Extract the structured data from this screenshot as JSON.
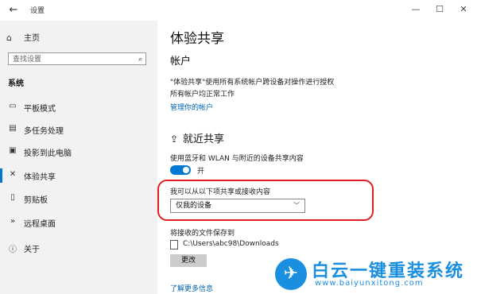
{
  "window": {
    "title": "设置",
    "controls": {
      "minimize": "—",
      "maximize": "☐",
      "close": "✕"
    },
    "back_glyph": "←"
  },
  "sidebar": {
    "home": {
      "label": "主页",
      "icon": "home-icon"
    },
    "search": {
      "placeholder": "查找设置",
      "icon": "search-icon"
    },
    "section_label": "系统",
    "items": [
      {
        "label": "平板模式",
        "icon": "tablet-icon"
      },
      {
        "label": "多任务处理",
        "icon": "multitask-icon"
      },
      {
        "label": "投影到此电脑",
        "icon": "project-icon"
      },
      {
        "label": "体验共享",
        "icon": "share-icon",
        "active": true
      },
      {
        "label": "剪贴板",
        "icon": "clipboard-icon"
      },
      {
        "label": "远程桌面",
        "icon": "remote-icon"
      },
      {
        "label": "关于",
        "icon": "info-icon"
      }
    ]
  },
  "main": {
    "page_title": "体验共享",
    "account": {
      "heading": "帐户",
      "line1": "\"体验共享\"使用所有系统帐户跨设备对操作进行授权",
      "line2": "所有帐户均正常工作",
      "manage_link": "管理你的帐户"
    },
    "nearby": {
      "heading": "就近共享",
      "icon": "nearby-share-icon",
      "bt_desc": "使用蓝牙和 WLAN 与附近的设备共享内容",
      "toggle_state": "开",
      "receive_label": "我可以从以下项共享或接收内容",
      "receive_value": "仅我的设备",
      "save_label": "将接收的文件保存到",
      "save_path": "C:\\Users\\abc98\\Downloads",
      "change_button": "更改"
    },
    "more_link": "了解更多信息"
  },
  "watermark": {
    "text": "白云一键重装系统",
    "url": "www.baiyunxitong.com"
  },
  "colors": {
    "accent": "#0078d4",
    "link": "#0063b1",
    "highlight": "#e21c23",
    "watermark": "#1a8fe0"
  }
}
